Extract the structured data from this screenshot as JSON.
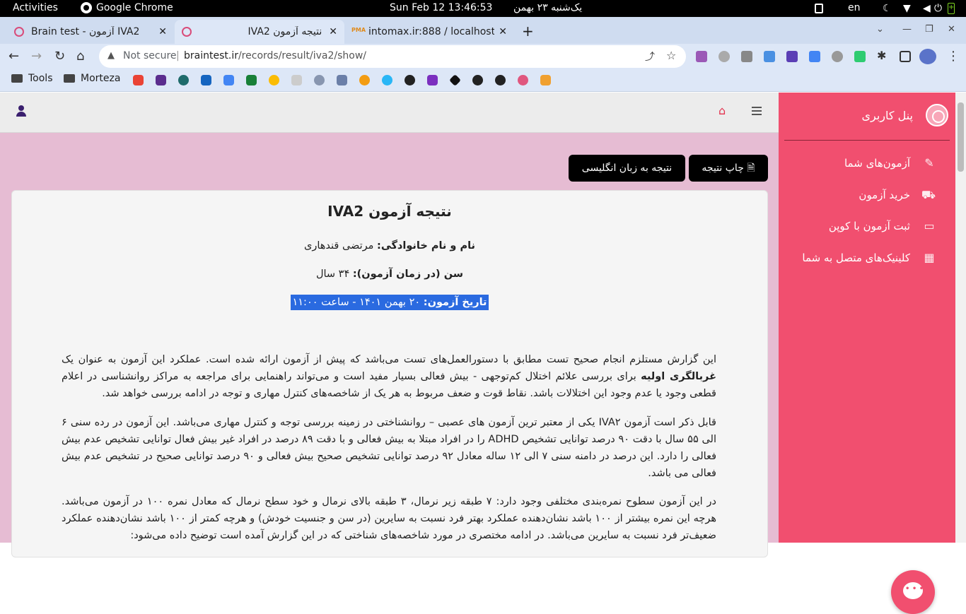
{
  "system_bar": {
    "activities": "Activities",
    "app_name": "Google Chrome",
    "clock": "Sun Feb 12  13:46:53",
    "persian_date": "یک‌شنبه ۲۳ بهمن",
    "language": "en"
  },
  "tabs": [
    {
      "title": "Brain test - آزمون IVA2",
      "active": false
    },
    {
      "title": "نتیجه آزمون IVA2",
      "active": true
    },
    {
      "title": "intomax.ir:888 / localhost",
      "active": false
    }
  ],
  "address_bar": {
    "security_label": "Not secure",
    "url_domain": "braintest.ir",
    "url_path": "/records/result/iva2/show/"
  },
  "bookmarks": [
    {
      "label": "Tools"
    },
    {
      "label": "Morteza"
    }
  ],
  "sidebar": {
    "brand": "پنل کاربری",
    "items": [
      {
        "label": "آزمون‌های شما",
        "icon": "pencil-icon"
      },
      {
        "label": "خرید آزمون",
        "icon": "cart-icon"
      },
      {
        "label": "ثبت آزمون با کوپن",
        "icon": "credit-card-icon"
      },
      {
        "label": "کلینیک‌های متصل به شما",
        "icon": "building-icon"
      }
    ]
  },
  "actions": {
    "print_label": "چاپ نتیجه",
    "english_label": "نتیجه به زبان انگلیسی"
  },
  "result": {
    "title": "نتیجه آزمون IVA2",
    "name_label": "نام و نام خانوادگی:",
    "name_value": "مرتضی قندهاری",
    "age_label": "سن (در زمان آزمون):",
    "age_value": "۳۴ سال",
    "date_label": "تاریخ آزمون:",
    "date_value": "۲۰ بهمن ۱۴۰۱ - ساعت ۱۱:۰۰",
    "p1_a": "این گزارش مستلزم انجام صحیح تست مطابق با دستورالعمل‌های تست می‌باشد که پیش از آزمون ارائه شده است. عملکرد این آزمون به عنوان یک",
    "p1_bold": "غربالگری اولیه",
    "p1_b": "برای بررسی علائم اختلال کم‌توجهی - بیش فعالی بسیار مفید است و می‌تواند راهنمایی برای مراجعه به مراکز روانشناسی در اعلام قطعی وجود یا عدم وجود این اختلالات باشد. نقاط قوت و ضعف مربوط به هر یک از شاخصه‌های کنترل مهاری و توجه در ادامه بررسی خواهد شد.",
    "p2": "قابل ذکر است آزمون IVA۲ یکی از معتبر ترین آزمون های عصبی – روانشناختی در زمینه بررسی توجه و کنترل مهاری می‌باشد. این آزمون در رده سنی ۶ الی ۵۵ سال با دقت ۹۰ درصد توانایی تشخیص ADHD را در افراد مبتلا به بیش فعالی و با دقت ۸۹ درصد در افراد غیر بیش فعال توانایی تشخیص عدم بیش فعالی را دارد. این درصد در دامنه سنی ۷ الی ۱۲ ساله معادل ۹۲ درصد توانایی تشخیص صحیح بیش فعالی و ۹۰ درصد توانایی صحیح در تشخیص عدم بیش فعالی می باشد.",
    "p3": "در این آزمون سطوح نمره‌بندی مختلفی وجود دارد: ۷ طبقه زیر نرمال، ۳ طبقه بالای نرمال و خود سطح نرمال که معادل نمره ۱۰۰ در آزمون می‌باشد. هرچه این نمره بیشتر از ۱۰۰ باشد نشان‌دهنده عملکرد بهتر فرد نسبت به سایرین (در سن و جنسیت خودش) و هرچه کمتر از ۱۰۰ باشد نشان‌دهنده عملکرد ضعیف‌تر فرد نسبت به سایرین می‌باشد. در ادامه مختصری در مورد شاخصه‌های شناختی که در این گزارش آمده است توضیح داده می‌شود:"
  },
  "colors": {
    "sidebar": "#f14f6f",
    "page_bg": "#e6bcd3",
    "selection": "#2a6ae0"
  }
}
